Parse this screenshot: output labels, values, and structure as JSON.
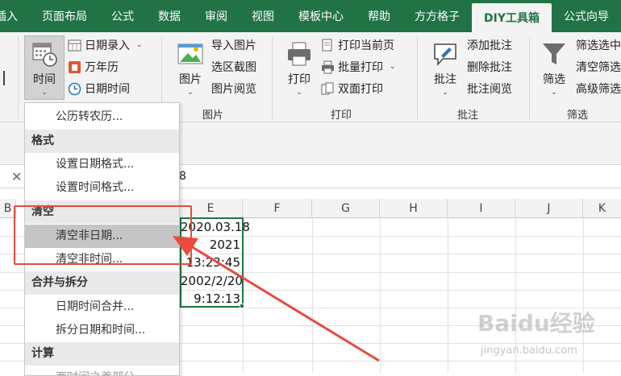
{
  "tabs": [
    "插入",
    "页面布局",
    "公式",
    "数据",
    "审阅",
    "视图",
    "模板中心",
    "帮助",
    "方方格子",
    "DIY工具箱",
    "公式向导"
  ],
  "active_tab": "DIY工具箱",
  "ribbon": {
    "time_group": {
      "time_button": "时间",
      "date_entry": "日期录入",
      "perpetual_calendar": "万年历",
      "date_time": "日期时间"
    },
    "picture_group": {
      "label": "图片",
      "picture_button": "图片",
      "import_picture": "导入图片",
      "region_screenshot": "选区截图",
      "picture_browse": "图片阅览"
    },
    "print_group": {
      "label": "打印",
      "print_button": "打印",
      "print_current_page": "打印当前页",
      "batch_print": "批量打印",
      "duplex_print": "双面打印"
    },
    "comment_group": {
      "label": "批注",
      "comment_button": "批注",
      "add_comment": "添加批注",
      "delete_comment": "删除批注",
      "comment_browse": "批注阅览"
    },
    "filter_group": {
      "label": "筛选",
      "filter_button": "筛选",
      "filter_selected": "筛选选中",
      "clear_filter": "清空筛选",
      "advanced_filter": "高级筛选"
    }
  },
  "formula_bar": {
    "value_fragment": "8"
  },
  "columns": [
    "B",
    "E",
    "F",
    "G",
    "H",
    "I",
    "J",
    "K"
  ],
  "cells_E": [
    "2020.03.18",
    "2021",
    "13:23:45",
    "2002/2/20",
    "9:12:13"
  ],
  "menu": {
    "item_gregorian": "公历转农历...",
    "head_format": "格式",
    "set_date_format": "设置日期格式...",
    "set_time_format": "设置时间格式...",
    "head_clear": "清空",
    "clear_non_date": "清空非日期...",
    "clear_non_time": "清空非时间...",
    "head_merge_split": "合并与拆分",
    "merge_date_time": "日期时间合并...",
    "split_date_time": "拆分日期和时间...",
    "head_calc": "计算",
    "partial_item": "两时间之差部分"
  },
  "watermark": {
    "logo": "Baidu经验",
    "url": "jingyan.baidu.com"
  },
  "colors": {
    "excel_green": "#217346",
    "annotation_red": "#e84a3e"
  }
}
